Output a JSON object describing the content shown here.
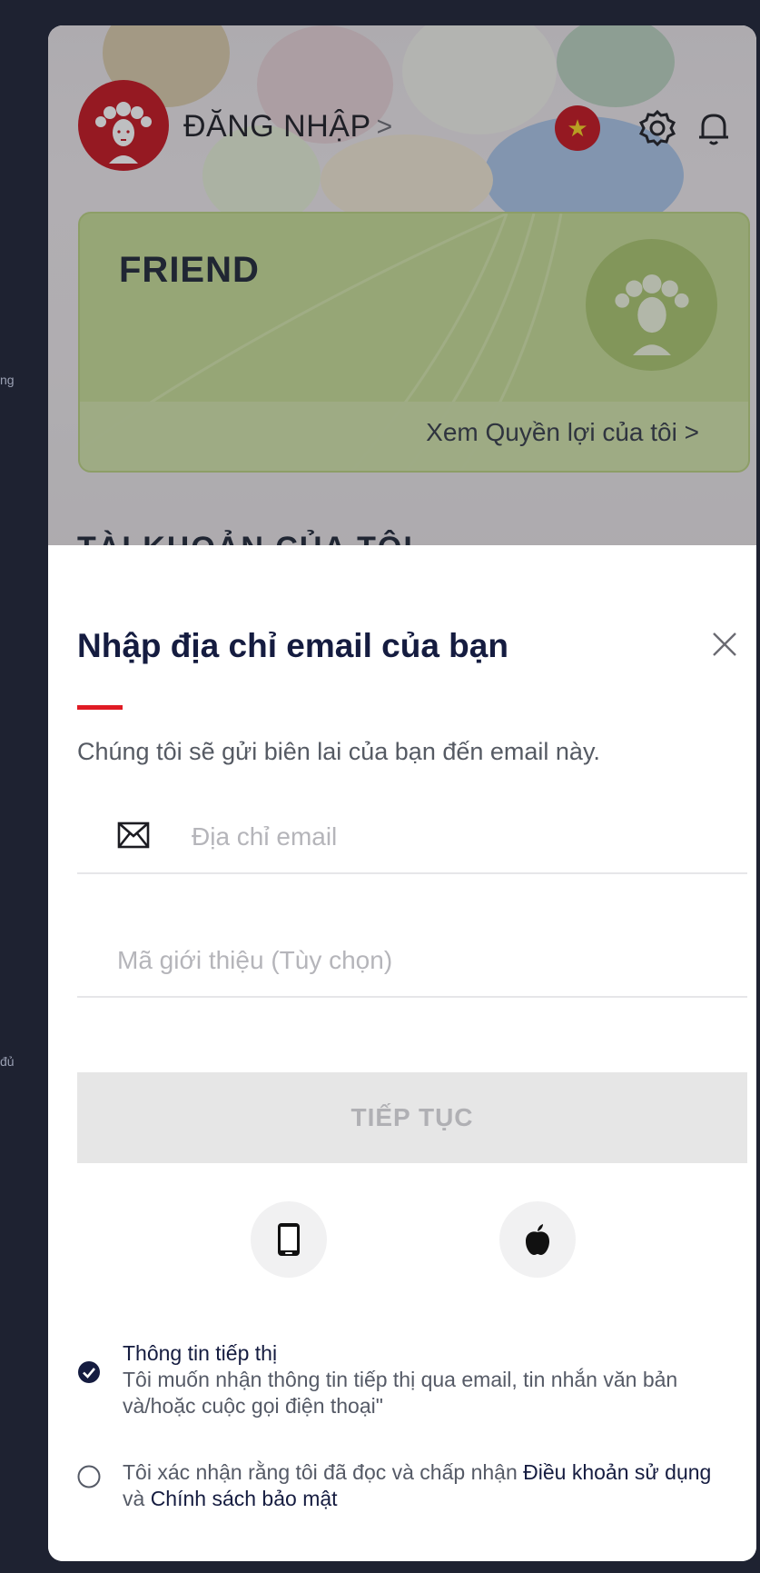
{
  "edge_texts": {
    "first": "ng",
    "second": "đủ"
  },
  "header": {
    "login_label": "ĐĂNG NHẬP",
    "login_chevron": ">",
    "flag_star": "★"
  },
  "member_card": {
    "tier": "FRIEND",
    "benefits_link": "Xem Quyền lợi của tôi",
    "benefits_chevron": ">"
  },
  "section_peek": "TÀI KHOẢN CỦA TÔI",
  "sheet": {
    "title": "Nhập địa chỉ email của bạn",
    "subtitle": "Chúng tôi sẽ gửi biên lai của bạn đến email này.",
    "email_placeholder": "Địa chỉ email",
    "referral_placeholder": "Mã giới thiệu (Tùy chọn)",
    "continue_label": "TIẾP TỤC",
    "marketing": {
      "heading": "Thông tin tiếp thị",
      "body": "Tôi muốn nhận thông tin tiếp thị qua email, tin nhắn văn bản và/hoặc cuộc gọi điện thoại\"",
      "checked": true
    },
    "terms": {
      "prefix": "Tôi xác nhận rằng tôi đã đọc và chấp nhận ",
      "terms_link": "Điều khoản sử dụng",
      "joiner": " và ",
      "privacy_link": "Chính sách bảo mật",
      "checked": false
    }
  },
  "colors": {
    "brand_red": "#e01b24",
    "navy_text": "#151c40",
    "card_green": "#c6dc94",
    "checked_fill": "#151c40"
  },
  "icons": {
    "settings": "gear-icon",
    "notifications": "bell-icon",
    "close": "close-icon",
    "mail": "mail-icon",
    "phone_login": "phone-icon",
    "apple_login": "apple-icon"
  }
}
